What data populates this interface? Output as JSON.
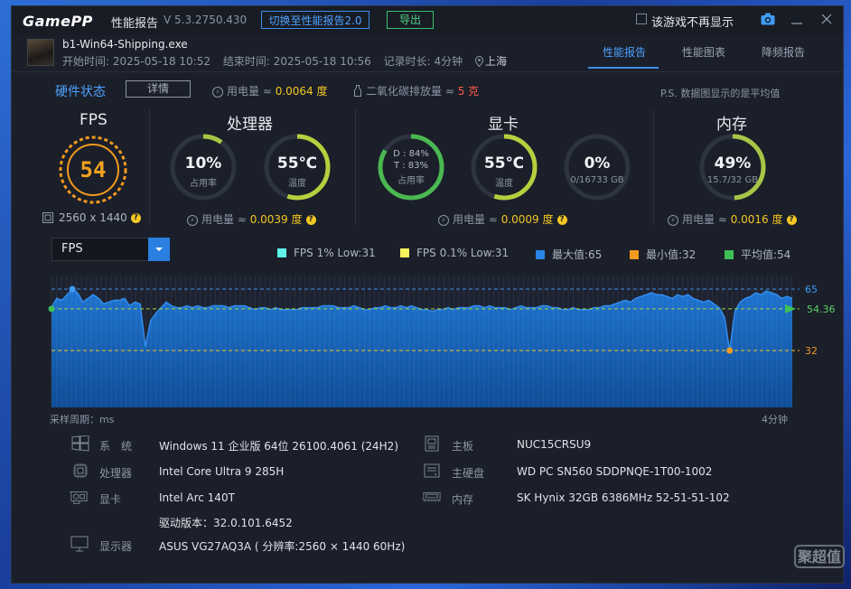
{
  "titlebar": {
    "logo": "GamePP",
    "title": "性能报告",
    "version": "V 5.3.2750.430",
    "switch_button": "切换至性能报告2.0",
    "export_button": "导出",
    "hide_checkbox_label": "该游戏不再显示"
  },
  "game": {
    "name": "b1-Win64-Shipping.exe",
    "start": "开始时间: 2025-05-18 10:52",
    "end": "结束时间: 2025-05-18 10:56",
    "duration": "记录时长: 4分钟",
    "location": "上海"
  },
  "tabs": [
    "性能报告",
    "性能图表",
    "降频报告"
  ],
  "active_tab": "性能报告",
  "hardware": {
    "label": "硬件状态",
    "detail_button": "详情",
    "power_prefix": "用电量 ≈",
    "power_value": "0.0064 度",
    "co2_prefix": "二氧化碳排放量 ≈",
    "co2_value": "5 克",
    "note": "P.S. 数据图显示的是平均值"
  },
  "fps": {
    "title": "FPS",
    "value": "54",
    "resolution": "2560 x 1440"
  },
  "cpu": {
    "title": "处理器",
    "usage_value": "10%",
    "usage_label": "占用率",
    "usage_fraction": 0.1,
    "temp_value": "55℃",
    "temp_label": "温度",
    "temp_fraction": 0.55,
    "power_prefix": "用电量 ≈",
    "power_value": "0.0039 度"
  },
  "gpu": {
    "title": "显卡",
    "d_usage": "D : 84%",
    "t_usage": "T : 83%",
    "usage_label": "占用率",
    "usage_fraction": 0.84,
    "temp_value": "55℃",
    "temp_label": "温度",
    "temp_fraction": 0.55,
    "vram_value": "0%",
    "vram_label": "0/16733 GB",
    "vram_fraction": 0.0,
    "power_prefix": "用电量 ≈",
    "power_value": "0.0009 度"
  },
  "memory": {
    "title": "内存",
    "usage_value": "49%",
    "usage_label": "15.7/32 GB",
    "usage_fraction": 0.49,
    "power_prefix": "用电量 ≈",
    "power_value": "0.0016 度"
  },
  "chart_select": "FPS",
  "legend": [
    {
      "label": "FPS 1% Low:31",
      "color": "#5ef2e9"
    },
    {
      "label": "FPS 0.1% Low:31",
      "color": "#f7f25c"
    },
    {
      "label": "最大值:65",
      "color": "#2a86e8"
    },
    {
      "label": "最小值:32",
      "color": "#f39a1f"
    },
    {
      "label": "平均值:54",
      "color": "#3fbf55"
    }
  ],
  "chart_data": {
    "type": "area",
    "title": "",
    "xlabel": "采样周期：ms",
    "x_end_label": "4分钟",
    "ylim": [
      0,
      70
    ],
    "max": 65,
    "min": 32,
    "avg": 54.36,
    "max_label": "65",
    "min_label": "32",
    "avg_label": "54.36",
    "values": [
      55,
      60,
      59,
      62,
      65,
      63,
      58,
      60,
      62,
      60,
      57,
      58,
      59,
      59,
      60,
      56,
      58,
      57,
      34,
      48,
      52,
      55,
      58,
      56,
      55,
      55,
      56,
      55,
      56,
      55,
      55,
      56,
      56,
      56,
      55,
      56,
      56,
      56,
      55,
      54,
      55,
      55,
      54,
      55,
      54,
      54,
      54,
      54,
      55,
      55,
      55,
      55,
      56,
      56,
      56,
      55,
      55,
      55,
      56,
      55,
      54,
      54,
      55,
      55,
      56,
      55,
      55,
      56,
      55,
      56,
      55,
      54,
      54,
      53,
      54,
      54,
      55,
      54,
      55,
      55,
      55,
      56,
      56,
      55,
      56,
      55,
      55,
      55,
      54,
      55,
      56,
      55,
      55,
      55,
      56,
      56,
      55,
      55,
      54,
      54,
      55,
      54,
      54,
      54,
      55,
      55,
      56,
      56,
      57,
      58,
      59,
      58,
      60,
      61,
      62,
      63,
      62,
      62,
      61,
      60,
      62,
      61,
      62,
      60,
      59,
      58,
      59,
      57,
      55,
      50,
      32,
      53,
      58,
      60,
      61,
      63,
      62,
      64,
      63,
      62,
      60,
      61,
      60
    ]
  },
  "specs": {
    "os_key": "系　统",
    "os_val": "Windows 11 企业版 64位 26100.4061 (24H2)",
    "cpu_key": "处理器",
    "cpu_val": "Intel Core Ultra 9 285H",
    "gpu_key": "显卡",
    "gpu_val": "Intel Arc 140T",
    "driver_val": "驱动版本：32.0.101.6452",
    "monitor_key": "显示器",
    "monitor_val": "ASUS VG27AQ3A ( 分辨率:2560 × 1440 60Hz)",
    "board_key": "主板",
    "board_val": "NUC15CRSU9",
    "disk_key": "主硬盘",
    "disk_val": "WD PC SN560 SDDPNQE-1T00-1002",
    "mem_key": "内存",
    "mem_val": "SK Hynix 32GB 6386MHz 52-51-51-102"
  },
  "watermark": "聚超值"
}
